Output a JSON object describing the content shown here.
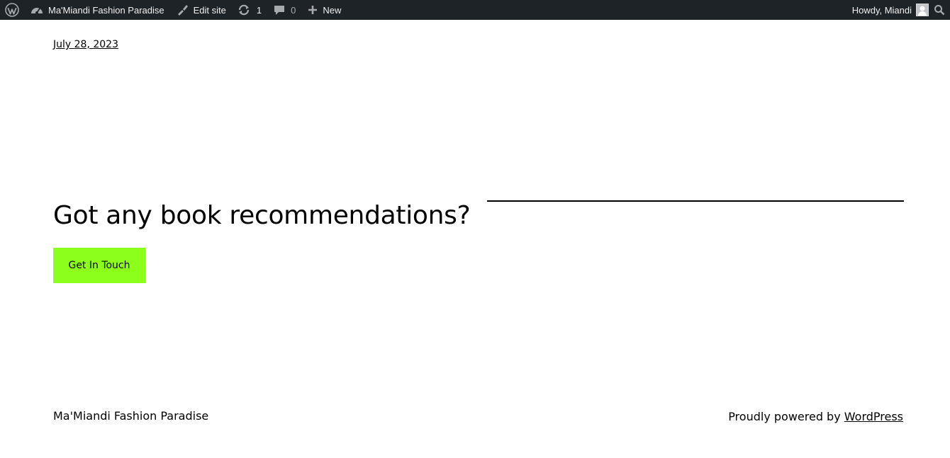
{
  "adminbar": {
    "wp_logo_icon": "wordpress-logo-icon",
    "site_name": "Ma'Miandi Fashion Paradise",
    "site_icon": "dashboard-icon",
    "edit_site_label": "Edit site",
    "edit_site_icon": "brush-icon",
    "updates_count": "1",
    "updates_icon": "updates-icon",
    "comments_count": "0",
    "comments_icon": "comment-icon",
    "new_label": "New",
    "new_icon": "plus-icon",
    "howdy": "Howdy, Miandi",
    "search_icon": "search-icon"
  },
  "post": {
    "date": "July 28, 2023"
  },
  "cta_section": {
    "heading": "Got any book recommendations?",
    "button_label": "Get In Touch",
    "button_color": "#8cff1a"
  },
  "footer": {
    "site_title": "Ma'Miandi Fashion Paradise",
    "credit_prefix": "Proudly powered by ",
    "credit_link": "WordPress"
  }
}
